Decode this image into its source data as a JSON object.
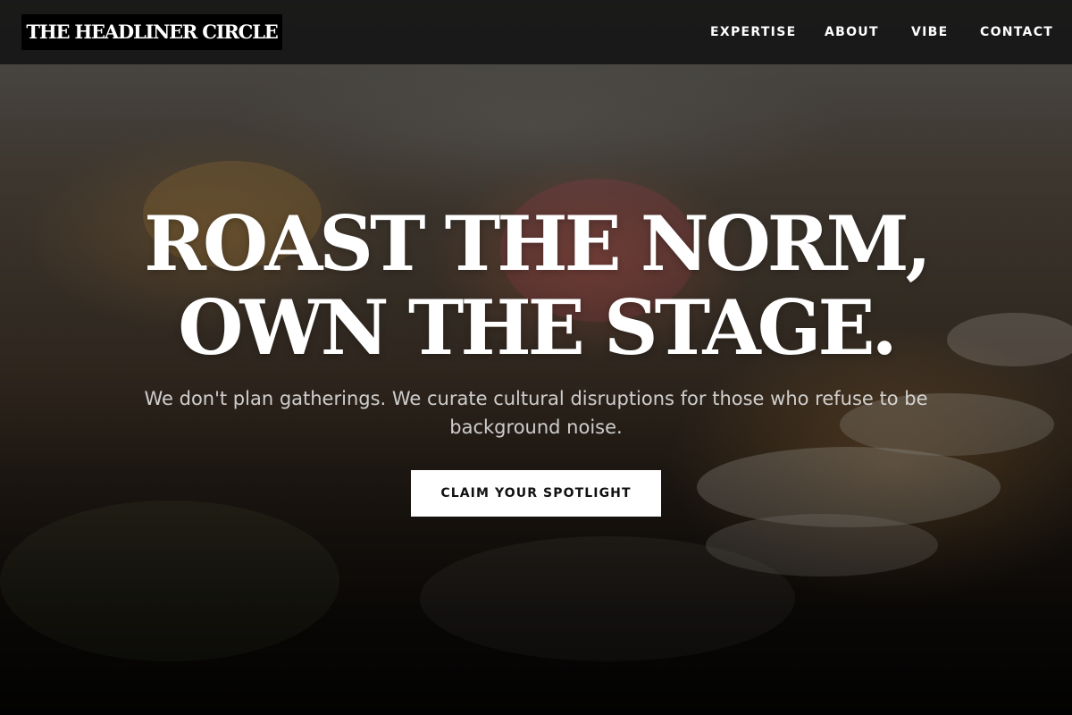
{
  "brand": {
    "logo_text": "THE HEADLINER CIRCLE"
  },
  "nav": {
    "items": [
      {
        "label": "EXPERTISE"
      },
      {
        "label": "ABOUT"
      },
      {
        "label": "VIBE"
      },
      {
        "label": "CONTACT"
      }
    ]
  },
  "hero": {
    "headline_line1": "ROAST THE NORM,",
    "headline_line2": "OWN THE STAGE.",
    "subtitle": "We don't plan gatherings. We curate cultural disruptions for those who refuse to be background noise.",
    "cta_label": "CLAIM YOUR SPOTLIGHT",
    "background_image": "banquet-table-photo"
  },
  "colors": {
    "navbar_bg": "#161616",
    "logo_bg": "#000000",
    "text": "#ffffff",
    "cta_bg": "#ffffff",
    "cta_text": "#111111"
  }
}
